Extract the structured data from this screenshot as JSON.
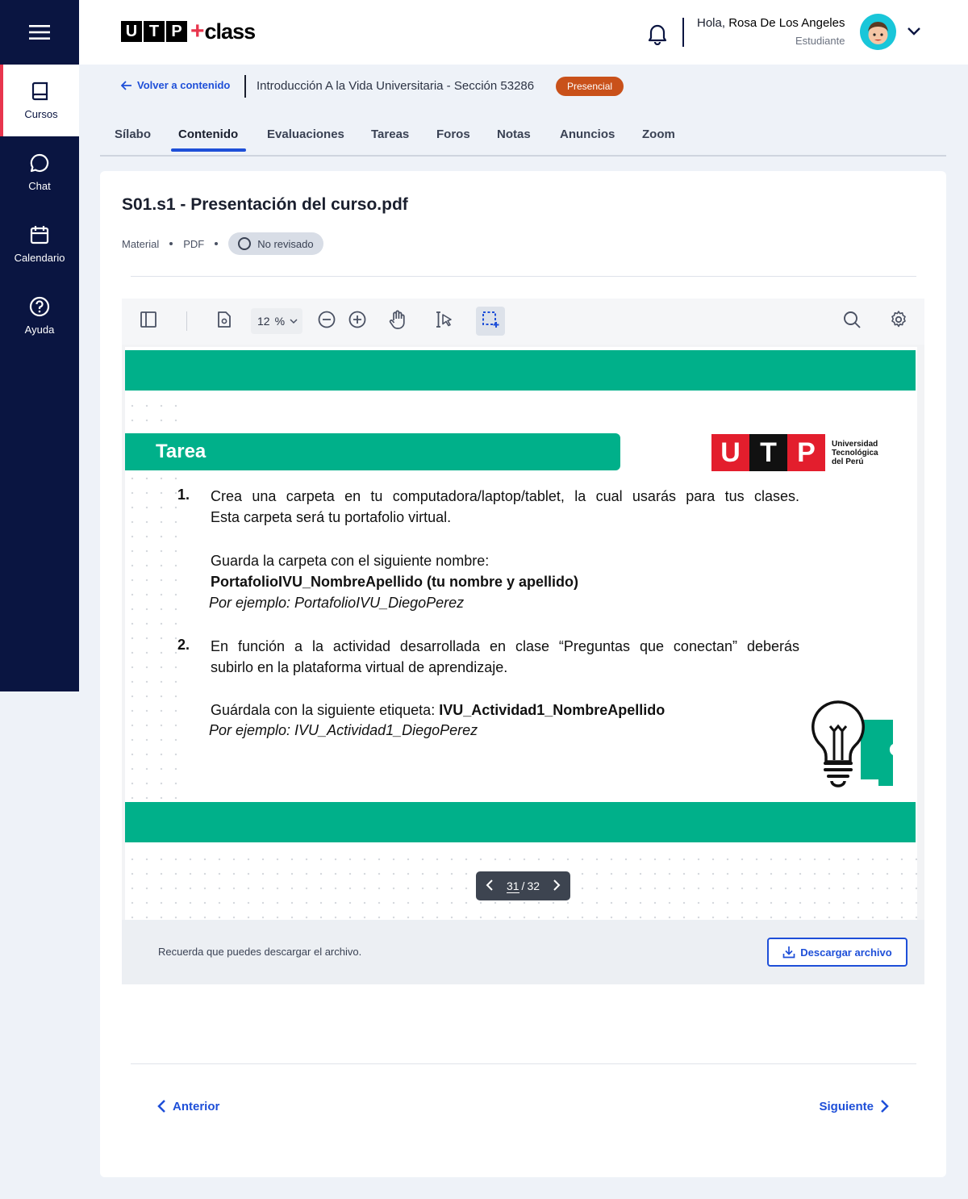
{
  "sidebar": {
    "items": [
      {
        "label": "Cursos",
        "icon": "book-icon"
      },
      {
        "label": "Chat",
        "icon": "chat-icon"
      },
      {
        "label": "Calendario",
        "icon": "calendar-icon"
      },
      {
        "label": "Ayuda",
        "icon": "help-icon"
      }
    ]
  },
  "header": {
    "logo_letters": [
      "U",
      "T",
      "P"
    ],
    "logo_plus": "+",
    "logo_word": "class",
    "greeting_prefix": "Hola,",
    "user_name": "Rosa De Los Angeles",
    "user_role": "Estudiante"
  },
  "course": {
    "back_label": "Volver a contenido",
    "title": "Introducción A la Vida Universitaria - Sección 53286",
    "modality": "Presencial"
  },
  "tabs": [
    "Sílabo",
    "Contenido",
    "Evaluaciones",
    "Tareas",
    "Foros",
    "Notas",
    "Anuncios",
    "Zoom"
  ],
  "active_tab": "Contenido",
  "document": {
    "title": "S01.s1 - Presentación del curso.pdf",
    "type_label": "Material",
    "format_label": "PDF",
    "status": "No revisado"
  },
  "viewer": {
    "zoom": "12",
    "zoom_unit": "%",
    "current_page": "31",
    "total_pages": "32"
  },
  "slide": {
    "heading": "Tarea",
    "utp_letters": [
      "U",
      "T",
      "P"
    ],
    "utp_name": [
      "Universidad",
      "Tecnológica",
      "del Perú"
    ],
    "item1_num": "1.",
    "item1_line1": "Crea una carpeta en tu computadora/laptop/tablet, la cual usarás para tus clases.",
    "item1_line2": "Esta carpeta será tu portafolio virtual.",
    "item1_save": "Guarda la carpeta con el siguiente nombre:",
    "item1_name": "PortafolioIVU_NombreApellido (tu nombre y apellido)",
    "item1_example": "Por ejemplo: PortafolioIVU_DiegoPerez",
    "item2_num": "2.",
    "item2_line1": "En función a la actividad desarrollada en clase “Preguntas que conectan” deberás",
    "item2_line2": "subirlo en la plataforma virtual de aprendizaje.",
    "item2_save_prefix": "Guárdala con la siguiente etiqueta: ",
    "item2_tag": "IVU_Actividad1_NombreApellido",
    "item2_example": "Por ejemplo: IVU_Actividad1_DiegoPerez"
  },
  "download": {
    "message": "Recuerda que puedes descargar el archivo.",
    "button_label": "Descargar archivo"
  },
  "pagination": {
    "prev_label": "Anterior",
    "next_label": "Siguiente"
  },
  "colors": {
    "sidebar_bg": "#0a1541",
    "accent_blue": "#1e4fd8",
    "badge_orange": "#c9511a",
    "slide_green": "#00b08a",
    "utp_red": "#e31e2d"
  }
}
